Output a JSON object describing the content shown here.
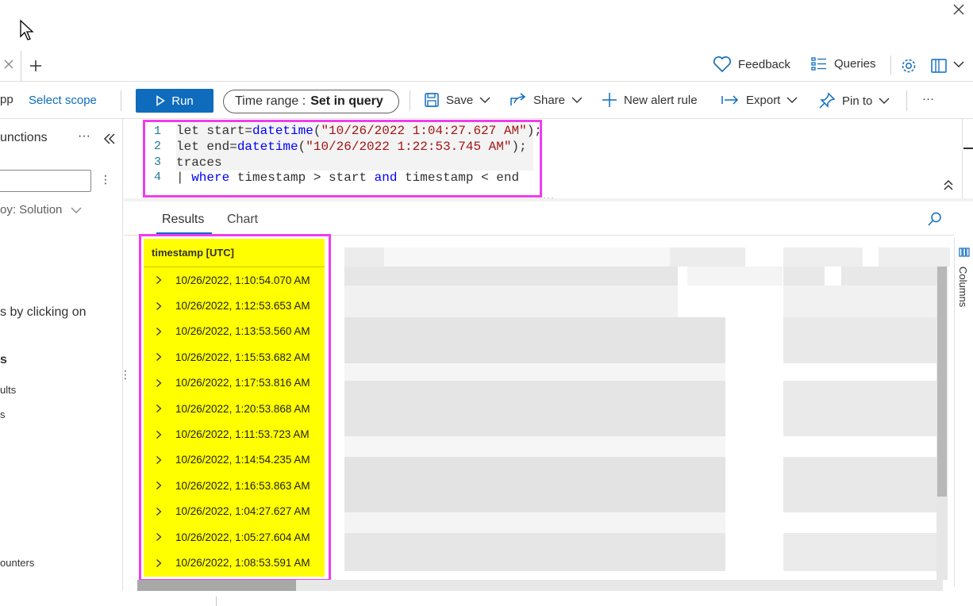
{
  "topbar": {
    "feedback_label": "Feedback",
    "queries_label": "Queries"
  },
  "commandbar": {
    "app_fragment": "pp",
    "select_scope": "Select scope",
    "run_label": "Run",
    "time_range_label": "Time range :",
    "time_range_value": "Set in query",
    "save_label": "Save",
    "share_label": "Share",
    "new_alert_label": "New alert rule",
    "export_label": "Export",
    "pin_label": "Pin to",
    "more_label": "···"
  },
  "sidebar": {
    "functions_label": "unctions",
    "more_label": "···",
    "groupby_label": "oy: Solution",
    "hint_text": "s by clicking on",
    "section_label": "s",
    "item_1": "ults",
    "item_2": "s",
    "item_3": "ounters"
  },
  "editor": {
    "lines": [
      {
        "num": "1"
      },
      {
        "num": "2"
      },
      {
        "num": "3"
      },
      {
        "num": "4"
      }
    ],
    "l1_a": "let start=",
    "l1_fn": "datetime",
    "l1_b": "(",
    "l1_str": "\"10/26/2022 1:04:27.627 AM\"",
    "l1_c": ");",
    "l2_a": "let end=",
    "l2_fn": "datetime",
    "l2_b": "(",
    "l2_str": "\"10/26/2022 1:22:53.745 AM\"",
    "l2_c": ");",
    "l3": "traces",
    "l4_pipe": "| ",
    "l4_kw1": "where",
    "l4_a": " timestamp > start ",
    "l4_kw2": "and",
    "l4_b": " timestamp < end"
  },
  "results": {
    "tab_results": "Results",
    "tab_chart": "Chart",
    "column_header": "timestamp [UTC]",
    "rows": [
      "10/26/2022, 1:10:54.070 AM",
      "10/26/2022, 1:12:53.653 AM",
      "10/26/2022, 1:13:53.560 AM",
      "10/26/2022, 1:15:53.682 AM",
      "10/26/2022, 1:17:53.816 AM",
      "10/26/2022, 1:20:53.868 AM",
      "10/26/2022, 1:11:53.723 AM",
      "10/26/2022, 1:14:54.235 AM",
      "10/26/2022, 1:16:53.863 AM",
      "10/26/2022, 1:04:27.627 AM",
      "10/26/2022, 1:05:27.604 AM",
      "10/26/2022, 1:08:53.591 AM"
    ],
    "columns_label": "Columns"
  },
  "colors": {
    "accent": "#0f6cbd",
    "highlight_border": "#f03cf0",
    "highlight_fill": "#ffff00"
  }
}
